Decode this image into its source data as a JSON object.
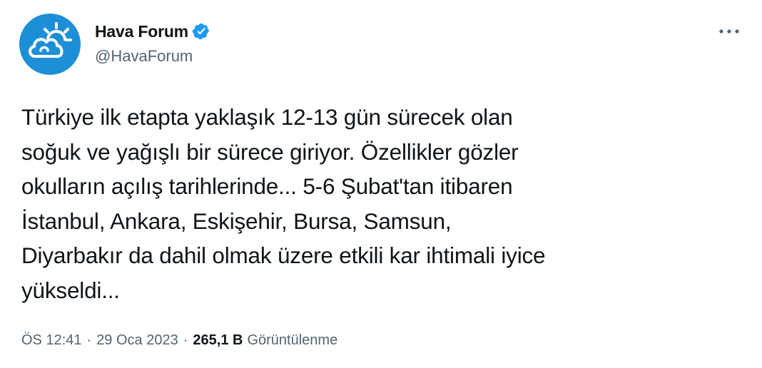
{
  "author": {
    "display_name": "Hava Forum",
    "handle": "@HavaForum",
    "verified_icon": "verified-badge-icon",
    "avatar_icon": "cloud-sun-logo-icon"
  },
  "tweet": {
    "text": "Türkiye ilk etapta yaklaşık 12-13 gün sürecek olan\nsoğuk ve yağışlı bir sürece giriyor. Özellikler gözler\nokulların açılış tarihlerinde... 5-6 Şubat'tan itibaren\nİstanbul, Ankara, Eskişehir, Bursa, Samsun,\nDiyarbakır da dahil olmak üzere etkili kar ihtimali iyice\nyükseldi..."
  },
  "meta": {
    "time": "ÖS 12:41",
    "separator": "·",
    "date": "29 Oca 2023",
    "views_count": "265,1 B",
    "views_label": "Görüntülenme"
  },
  "menu": {
    "icon": "more-options-icon"
  },
  "colors": {
    "brand_blue": "#1d9bf0",
    "avatar_blue": "#1d8fd6",
    "text_primary": "#0f1419",
    "text_secondary": "#536471"
  }
}
